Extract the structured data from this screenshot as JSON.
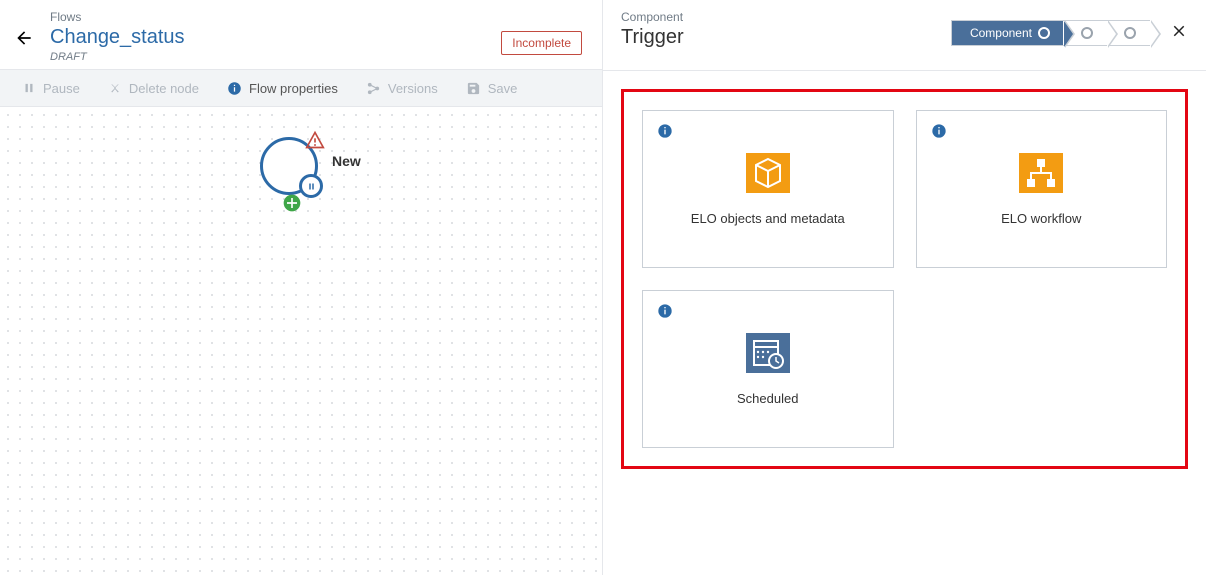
{
  "left": {
    "eyebrow": "Flows",
    "title": "Change_status",
    "subtitle": "DRAFT",
    "status_badge": "Incomplete"
  },
  "toolbar": {
    "pause": "Pause",
    "delete": "Delete node",
    "properties": "Flow properties",
    "versions": "Versions",
    "save": "Save"
  },
  "node": {
    "label": "New"
  },
  "right": {
    "eyebrow": "Component",
    "title": "Trigger",
    "step_active_label": "Component"
  },
  "cards": {
    "objects": "ELO objects and metadata",
    "workflow": "ELO workflow",
    "scheduled": "Scheduled"
  }
}
